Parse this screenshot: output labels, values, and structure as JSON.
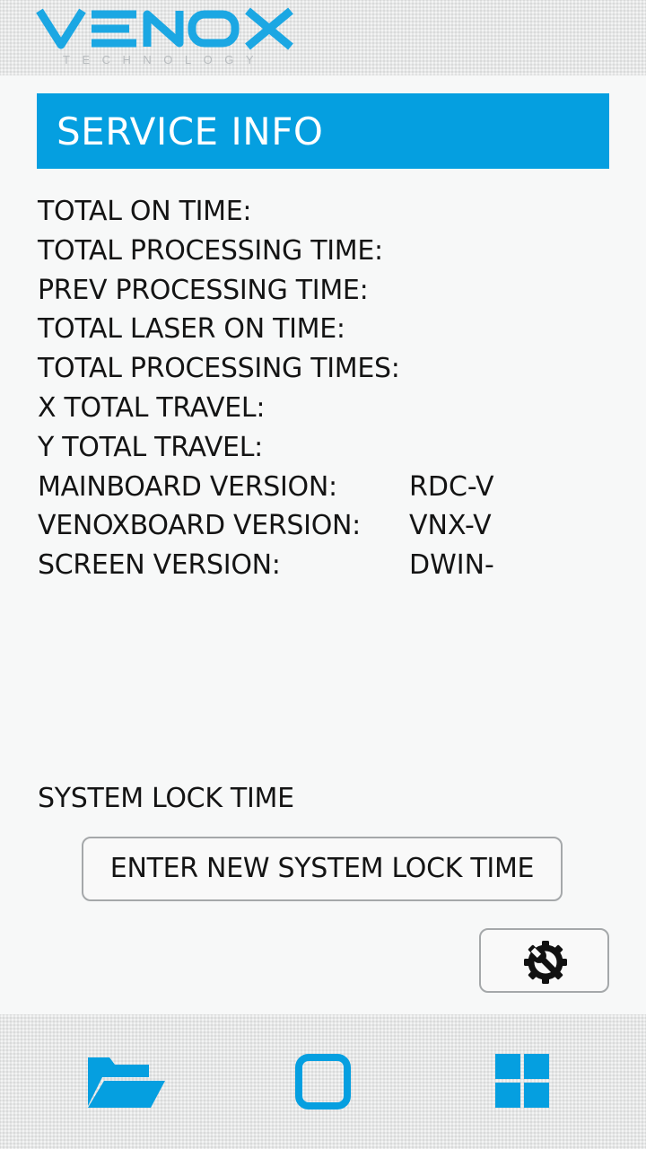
{
  "brand": {
    "tagline": "TECHNOLOGY"
  },
  "title": "SERVICE INFO",
  "info_rows": [
    {
      "label": "TOTAL ON TIME:",
      "value": ""
    },
    {
      "label": "TOTAL PROCESSING TIME:",
      "value": ""
    },
    {
      "label": "PREV PROCESSING TIME:",
      "value": ""
    },
    {
      "label": "TOTAL LASER ON TIME:",
      "value": ""
    },
    {
      "label": "TOTAL PROCESSING TIMES:",
      "value": ""
    },
    {
      "label": "X TOTAL TRAVEL:",
      "value": ""
    },
    {
      "label": "Y TOTAL TRAVEL:",
      "value": ""
    },
    {
      "label": "MAINBOARD VERSION:",
      "value": "RDC-V"
    },
    {
      "label": "VENOXBOARD VERSION:",
      "value": "VNX-V"
    },
    {
      "label": "SCREEN VERSION:",
      "value": "DWIN-"
    }
  ],
  "system_lock": {
    "label": "SYSTEM LOCK TIME",
    "button_label": "ENTER NEW SYSTEM LOCK TIME"
  },
  "icons": {
    "logo": "venox-logo",
    "tool": "wrench-gear-icon",
    "nav_files": "folder-icon",
    "nav_home": "square-icon",
    "nav_menu": "grid-icon"
  },
  "colors": {
    "accent": "#059fe0",
    "logo": "#1ba7e3",
    "text": "#141414"
  }
}
